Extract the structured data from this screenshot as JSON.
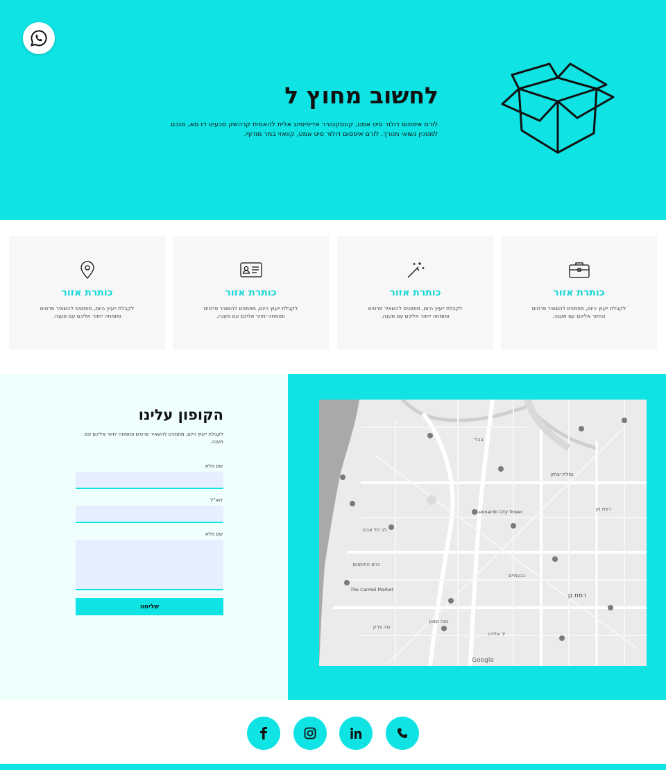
{
  "hero": {
    "title": "לחשוב מחוץ ל",
    "text": "לורם איפסום דולור סיט אמט, קונסקטורר אדיפיסינג אלית להאמית קרהשק סכעיט דז מא, מנכם למטכין נשואי מנורך. לורם איפסום דולור סיט אמט, קוואזי במר מודוף.",
    "box_icon": "open-box-icon",
    "whatsapp_icon": "whatsapp-icon"
  },
  "features": [
    {
      "icon": "briefcase-icon",
      "title": "כותרת אזור",
      "text": "לקבלת ייעוץ היום, מוזמנים להשאיר פרטים ונחזור אליכם עם מענה."
    },
    {
      "icon": "magic-wand-icon",
      "title": "כותרת אזור",
      "text": "לקבלת ייעוץ היום, מוזמנים להשאיר פרטים ומומחה יחזור אליכם עם מענה."
    },
    {
      "icon": "id-card-icon",
      "title": "כותרת אזור",
      "text": "לקבלת ייעוץ היום, מוזמנים להשאיר פרטים ומומחה יחזור אליכם עם מענה."
    },
    {
      "icon": "location-pin-icon",
      "title": "כותרת אזור",
      "text": "לקבלת ייעוץ היום, מוזמנים להשאיר פרטים ומומחה יחזור אליכם עם מענה."
    }
  ],
  "contact": {
    "title": "הקופון עלינו",
    "subtitle": "לקבלת ייעוץ היום, מוזמנים להשאיר פרטים ומומחה יחזור אליכם עם מענה.",
    "name_label": "שם מלא",
    "email_label": "דוא\"ל",
    "message_label": "שם מלא",
    "name_value": "",
    "email_value": "",
    "message_value": "",
    "submit_label": "שליחה"
  },
  "map": {
    "labels": [
      "רמת גן",
      "נחלת יצחק",
      "נוה צדק",
      "The Carmel Market",
      "Leonardo City Tower",
      "גבעתיים",
      "כרם התימנים",
      "רמת חן",
      "יד אליהו",
      "בבלי",
      "נווה שאנן",
      "לב תל אביב"
    ],
    "attribution": "Google"
  },
  "social": [
    {
      "name": "facebook",
      "icon": "facebook-icon"
    },
    {
      "name": "instagram",
      "icon": "instagram-icon"
    },
    {
      "name": "linkedin",
      "icon": "linkedin-icon"
    },
    {
      "name": "phone",
      "icon": "phone-icon"
    }
  ],
  "colors": {
    "accent": "#0fe3e3",
    "card_bg": "#f7f7f7",
    "form_bg": "#effffd",
    "input_bg": "#e6efff",
    "feature_title": "#17d6d6"
  }
}
